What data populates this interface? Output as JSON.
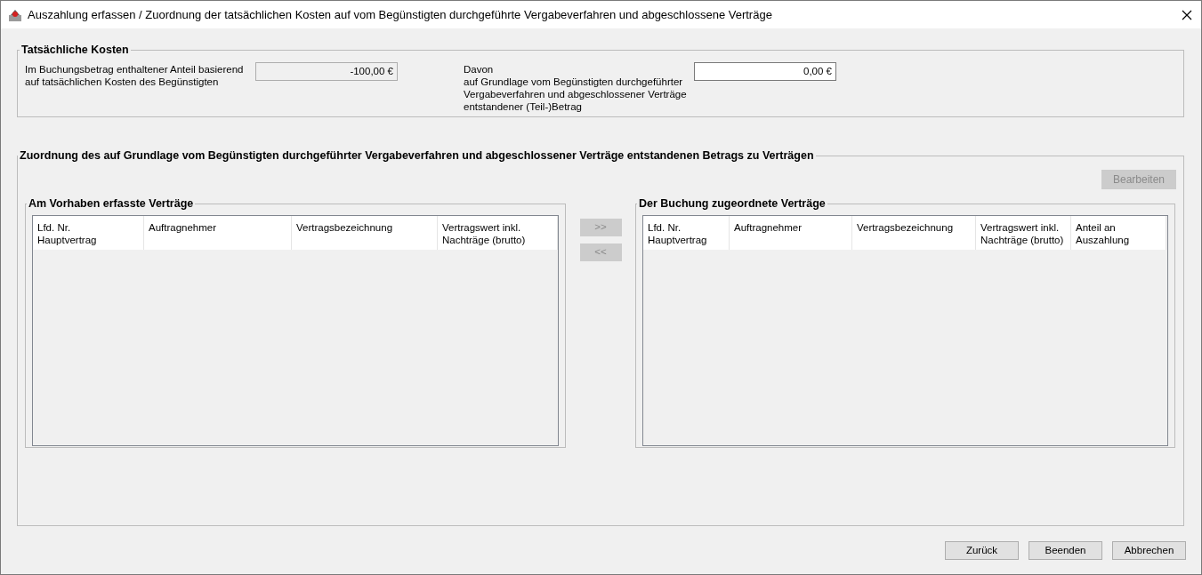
{
  "window": {
    "title": "Auszahlung erfassen / Zuordnung der tatsächlichen Kosten auf vom Begünstigten durchgeführte Vergabeverfahren und abgeschlossene Verträge"
  },
  "actual_costs": {
    "title": "Tatsächliche Kosten",
    "fields": [
      {
        "label": "Im Buchungsbetrag enthaltener Anteil basierend\nauf tatsächlichen Kosten des Begünstigten",
        "value": "-100,00 €",
        "disabled": true
      },
      {
        "label": "Davon\nauf Grundlage vom Begünstigten durchgeführter\nVergabeverfahren und abgeschlossener Verträge\nentstandener (Teil-)Betrag",
        "value": "0,00 €",
        "disabled": false
      }
    ]
  },
  "assignment": {
    "title": "Zuordnung des auf Grundlage vom Begünstigten durchgeführter Vergabeverfahren und abgeschlossener Verträge entstandenen Betrags zu Verträgen",
    "edit_button": {
      "label": "Bearbeiten",
      "disabled": true
    },
    "left_table": {
      "title": "Am Vorhaben erfasste Verträge",
      "columns": [
        {
          "label": "Lfd. Nr.\nHauptvertrag"
        },
        {
          "label": "Auftragnehmer"
        },
        {
          "label": "Vertragsbezeichnung"
        },
        {
          "label": "Vertragswert inkl.\nNachträge (brutto)"
        }
      ]
    },
    "move_buttons": [
      {
        "label": ">>",
        "disabled": true
      },
      {
        "label": "<<",
        "disabled": true
      }
    ],
    "right_table": {
      "title": "Der Buchung zugeordnete Verträge",
      "columns": [
        {
          "label": "Lfd. Nr.\nHauptvertrag"
        },
        {
          "label": "Auftragnehmer"
        },
        {
          "label": "Vertragsbezeichnung"
        },
        {
          "label": "Vertragswert inkl.\nNachträge (brutto)"
        },
        {
          "label": "Anteil an\nAuszahlung"
        }
      ]
    }
  },
  "footer_buttons": [
    {
      "label": "Zurück",
      "disabled": false
    },
    {
      "label": "Beenden",
      "disabled": false
    },
    {
      "label": "Abbrechen",
      "disabled": false
    }
  ]
}
